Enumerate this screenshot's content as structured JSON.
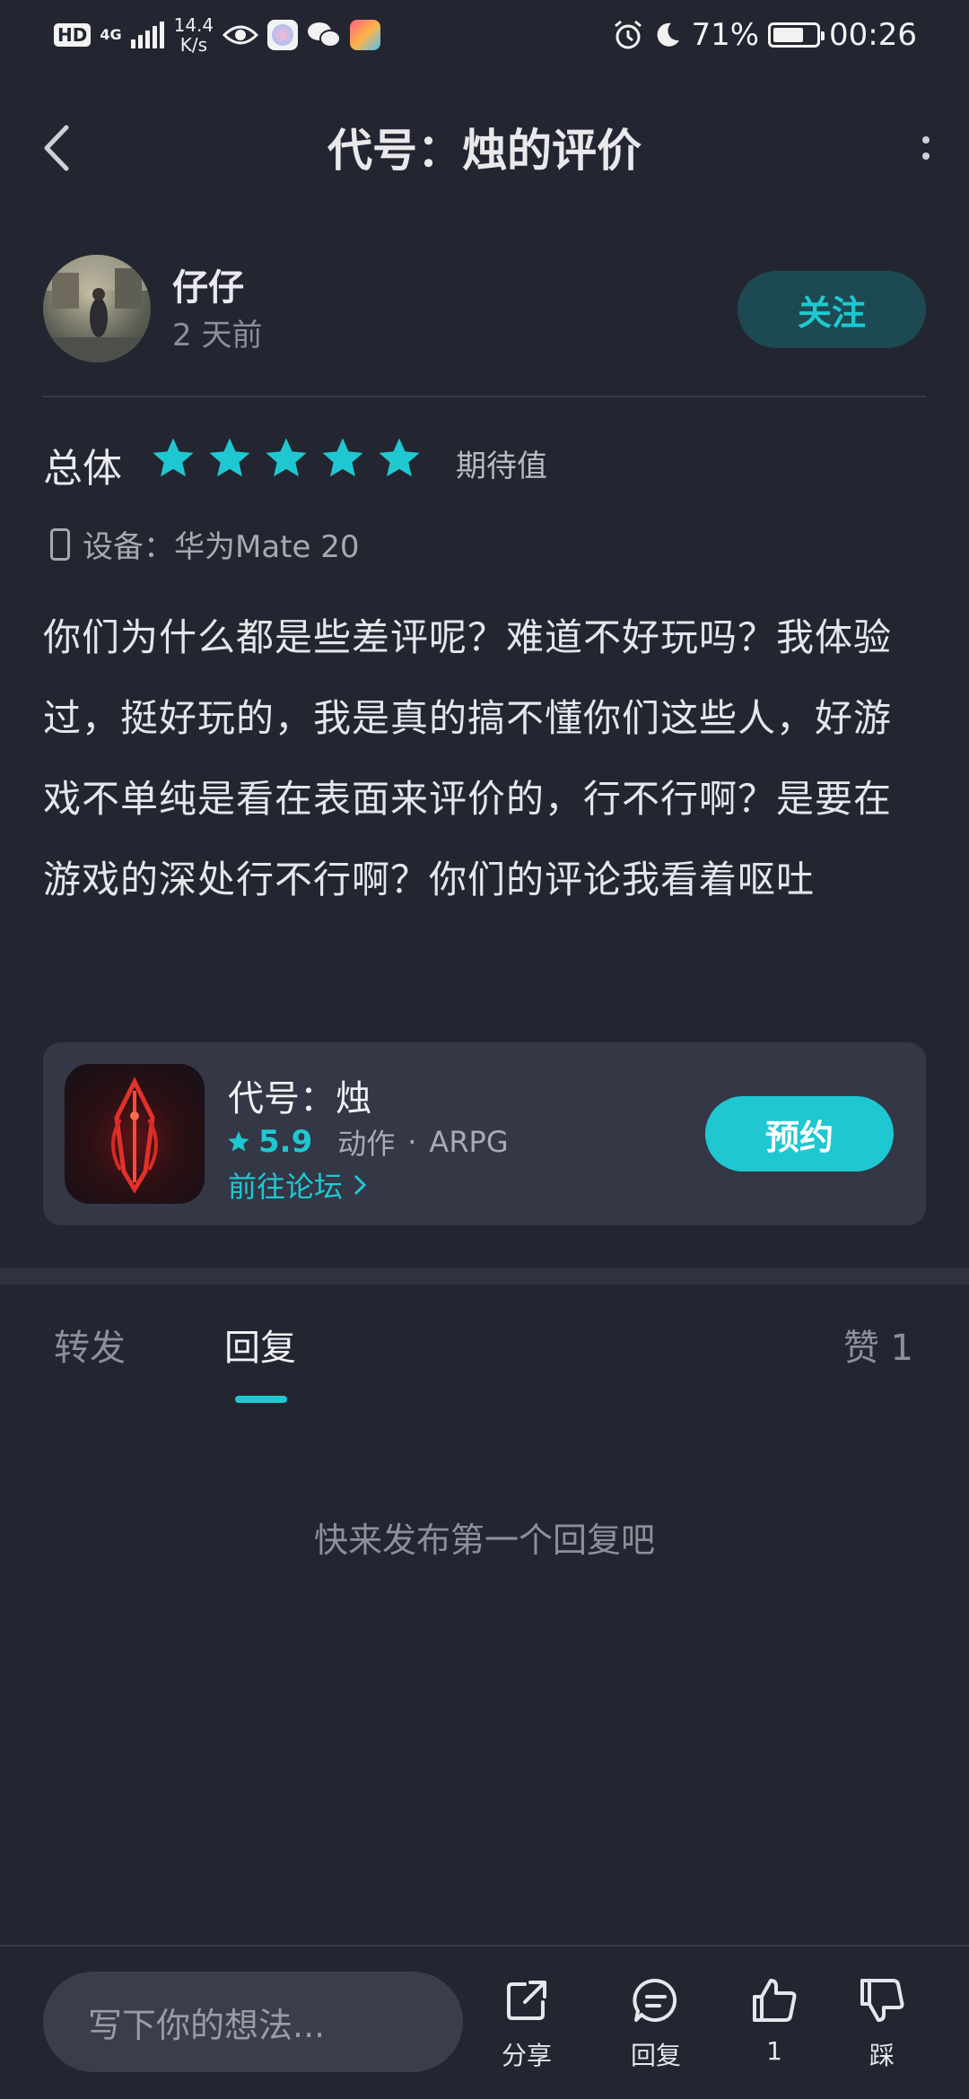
{
  "status_bar": {
    "hd": "HD",
    "network": "4G",
    "speed_value": "14.4",
    "speed_unit": "K/s",
    "battery": "71%",
    "battery_level": 0.71,
    "time": "00:26"
  },
  "header": {
    "title": "代号：烛的评价"
  },
  "user": {
    "name": "仔仔",
    "time": "2 天前",
    "follow_label": "关注"
  },
  "rating": {
    "overall_label": "总体",
    "stars": 5,
    "star_color": "#1fc8d1",
    "expect_label": "期待值"
  },
  "device": {
    "label": "设备：华为Mate 20"
  },
  "review": {
    "text": "你们为什么都是些差评呢？难道不好玩吗？我体验过，挺好玩的，我是真的搞不懂你们这些人，好游戏不单纯是看在表面来评价的，行不行啊？是要在游戏的深处行不行啊？你们的评论我看着呕吐"
  },
  "game_card": {
    "name": "代号：烛",
    "score": "5.9",
    "genre": "动作",
    "dot": "·",
    "tag": "ARPG",
    "forum_link": "前往论坛",
    "reserve_label": "预约"
  },
  "tabs": {
    "forward": "转发",
    "reply": "回复",
    "likes": "赞 1"
  },
  "empty_state": "快来发布第一个回复吧",
  "bottom_bar": {
    "input_placeholder": "写下你的想法...",
    "share_label": "分享",
    "reply_label": "回复",
    "like_count": "1",
    "dislike_label": "踩"
  },
  "colors": {
    "background": "#232631",
    "accent": "#1fc8d1",
    "card": "#333746"
  }
}
